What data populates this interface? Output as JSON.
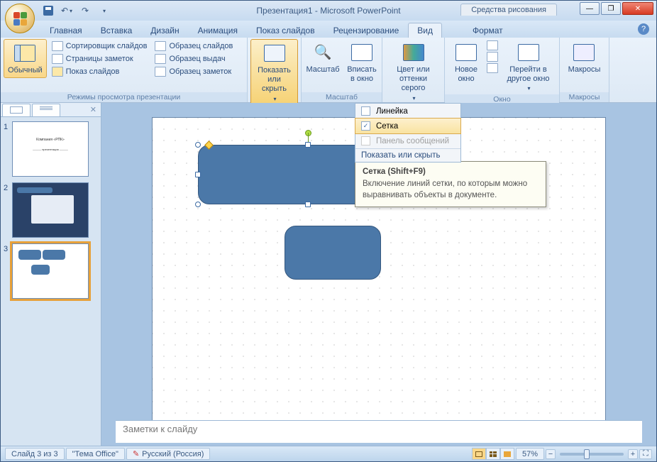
{
  "title": "Презентация1 - Microsoft PowerPoint",
  "contextual_tool": "Средства рисования",
  "tabs": {
    "home": "Главная",
    "insert": "Вставка",
    "design": "Дизайн",
    "animations": "Анимация",
    "slideshow": "Показ слайдов",
    "review": "Рецензирование",
    "view": "Вид",
    "format": "Формат"
  },
  "ribbon": {
    "groups": {
      "views": {
        "label": "Режимы просмотра презентации",
        "normal": "Обычный",
        "sorter": "Сортировщик слайдов",
        "notes_page": "Страницы заметок",
        "slideshow": "Показ слайдов",
        "master_slide": "Образец слайдов",
        "master_handout": "Образец выдач",
        "master_notes": "Образец заметок"
      },
      "show_hide": {
        "label": "Показать или скрыть"
      },
      "zoom": {
        "label": "Масштаб",
        "zoom": "Масштаб",
        "fit": "Вписать в окно"
      },
      "color": {
        "label": "",
        "btn": "Цвет или оттенки серого"
      },
      "window": {
        "label": "Окно",
        "new": "Новое окно",
        "switch": "Перейти в другое окно"
      },
      "macros": {
        "label": "Макросы",
        "btn": "Макросы"
      }
    }
  },
  "dropdown": {
    "ruler": "Линейка",
    "grid": "Сетка",
    "message_bar": "Панель сообщений",
    "footer": "Показать или скрыть"
  },
  "tooltip": {
    "title": "Сетка (Shift+F9)",
    "body": "Включение линий сетки, по которым можно выравнивать объекты в документе."
  },
  "notes_placeholder": "Заметки к слайду",
  "status": {
    "slide": "Слайд 3 из 3",
    "theme": "\"Тема Office\"",
    "lang": "Русский (Россия)",
    "zoom": "57%"
  },
  "thumb1_text": "Компания «РПК»",
  "thumb1_sub": "——— презентация ———"
}
